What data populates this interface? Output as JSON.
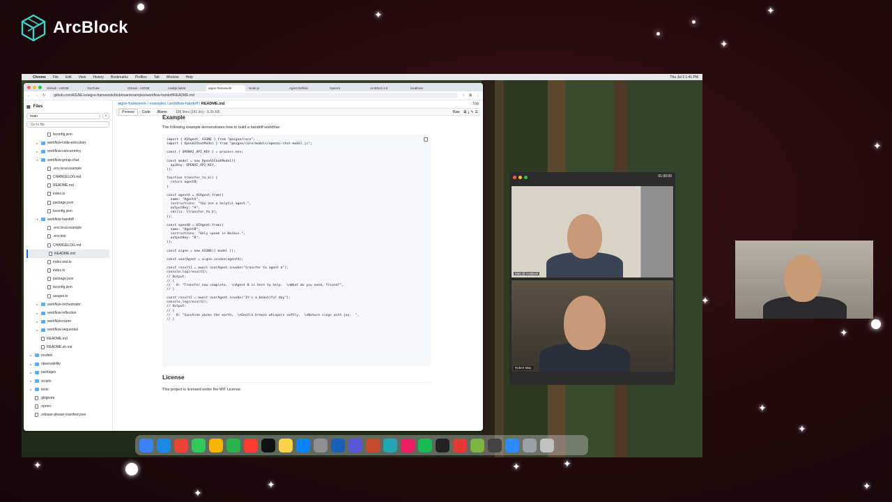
{
  "brand": {
    "name": "ArcBlock"
  },
  "menubar": {
    "items": [
      "Chrome",
      "File",
      "Edit",
      "View",
      "History",
      "Bookmarks",
      "Profiles",
      "Tab",
      "Window",
      "Help"
    ],
    "clock": "Thu Jul 3 1:41 PM"
  },
  "browser": {
    "tabs": [
      "GitHub - AIGNE",
      "YouTube",
      "GitHub - AIGNE",
      "nodejs latest",
      "aigne-framework",
      "Node.js",
      "Agent Definiti",
      "OpenAI",
      "ArcBlock 2.0",
      "localhost"
    ],
    "active_tab": 4,
    "url": "github.com/AIGNE-io/aigne-framework/blob/main/examples/workflow-handoff/README.md"
  },
  "sidebar": {
    "title": "Files",
    "branch": "main",
    "goto_placeholder": "Go to file",
    "items": [
      {
        "label": "tsconfig.json",
        "type": "file",
        "depth": 2
      },
      {
        "label": "workflow-code-execution",
        "type": "folder",
        "depth": 1
      },
      {
        "label": "workflow-concurrency",
        "type": "folder",
        "depth": 1
      },
      {
        "label": "workflow-group-chat",
        "type": "folder",
        "depth": 1,
        "open": true
      },
      {
        "label": ".env.local.example",
        "type": "file",
        "depth": 2
      },
      {
        "label": "CHANGELOG.md",
        "type": "file",
        "depth": 2
      },
      {
        "label": "README.md",
        "type": "file",
        "depth": 2
      },
      {
        "label": "index.ts",
        "type": "file",
        "depth": 2
      },
      {
        "label": "package.json",
        "type": "file",
        "depth": 2
      },
      {
        "label": "tsconfig.json",
        "type": "file",
        "depth": 2
      },
      {
        "label": "workflow-handoff",
        "type": "folder",
        "depth": 1,
        "open": true
      },
      {
        "label": ".env.local.example",
        "type": "file",
        "depth": 2
      },
      {
        "label": ".env.test",
        "type": "file",
        "depth": 2
      },
      {
        "label": "CHANGELOG.md",
        "type": "file",
        "depth": 2
      },
      {
        "label": "README.md",
        "type": "file",
        "depth": 2,
        "selected": true
      },
      {
        "label": "index.test.ts",
        "type": "file",
        "depth": 2
      },
      {
        "label": "index.ts",
        "type": "file",
        "depth": 2
      },
      {
        "label": "package.json",
        "type": "file",
        "depth": 2
      },
      {
        "label": "tsconfig.json",
        "type": "file",
        "depth": 2
      },
      {
        "label": "usages.ts",
        "type": "file",
        "depth": 2
      },
      {
        "label": "workflow-orchestrator",
        "type": "folder",
        "depth": 1
      },
      {
        "label": "workflow-reflection",
        "type": "folder",
        "depth": 1
      },
      {
        "label": "workflow-router",
        "type": "folder",
        "depth": 1
      },
      {
        "label": "workflow-sequential",
        "type": "folder",
        "depth": 1
      },
      {
        "label": "README.md",
        "type": "file",
        "depth": 1
      },
      {
        "label": "README.zh.md",
        "type": "file",
        "depth": 1
      },
      {
        "label": "models",
        "type": "folder",
        "depth": 0
      },
      {
        "label": "observability",
        "type": "folder",
        "depth": 0
      },
      {
        "label": "packages",
        "type": "folder",
        "depth": 0
      },
      {
        "label": "scripts",
        "type": "folder",
        "depth": 0
      },
      {
        "label": "tests",
        "type": "folder",
        "depth": 0
      },
      {
        "label": ".gitignore",
        "type": "file",
        "depth": 0
      },
      {
        "label": ".npmrc",
        "type": "file",
        "depth": 0
      },
      {
        "label": ".release-please-manifest.json",
        "type": "file",
        "depth": 0
      }
    ]
  },
  "breadcrumb": {
    "repo": "aigne-framework",
    "path": " / examples / workflow-handoff / ",
    "file": "README.md",
    "top": "Top"
  },
  "filebar": {
    "tabs": [
      "Preview",
      "Code",
      "Blame"
    ],
    "meta": "196 lines (141 loc) · 5.35 KB",
    "raw": "Raw"
  },
  "readme": {
    "partial_heading": "Example",
    "intro": "The following example demonstrates how to build a handoff workflow:",
    "code": [
      "import { AIAgent, AIGNE } from \"@aigne/core\";",
      "import { OpenAIChatModel } from \"@aigne/core/models/openai-chat-model.js\";",
      "",
      "const { OPENAI_API_KEY } = process.env;",
      "",
      "const model = new OpenAIChatModel({",
      "  apiKey: OPENAI_API_KEY,",
      "});",
      "",
      "function transfer_to_b() {",
      "  return agentB;",
      "}",
      "",
      "const agentA = AIAgent.from({",
      "  name: \"AgentA\",",
      "  instructions: \"You are a helpful agent.\",",
      "  outputKey: \"A\",",
      "  skills: [transfer_to_b],",
      "});",
      "",
      "const agentB = AIAgent.from({",
      "  name: \"AgentB\",",
      "  instructions: \"Only speak in Haikus.\",",
      "  outputKey: \"B\",",
      "});",
      "",
      "const aigne = new AIGNE({ model });",
      "",
      "const userAgent = aigne.invoke(agentA);",
      "",
      "const result1 = await userAgent.invoke(\"transfer to agent b\");",
      "console.log(result1);",
      "// Output:",
      "// {",
      "//   B: \"Transfer now complete,  \\nAgent B is here to help.  \\nWhat do you need, friend?\",",
      "// }",
      "",
      "const result2 = await userAgent.invoke(\"It's a beautiful day\");",
      "console.log(result2);",
      "// Output:",
      "// {",
      "//   B: \"Sunshine warms the earth,  \\nGentle breeze whispers softly,  \\nNature sings with joy.  \",",
      "// }"
    ],
    "license_heading": "License",
    "license_text": "This project is licensed under the MIT License."
  },
  "call": {
    "timer": "01:00:06",
    "participants": [
      "Matt @ ArcBlock",
      "Robert Mao"
    ]
  },
  "colors": {
    "link": "#0969da",
    "folder": "#54aeff",
    "brand_teal": "#3fd0c9"
  }
}
